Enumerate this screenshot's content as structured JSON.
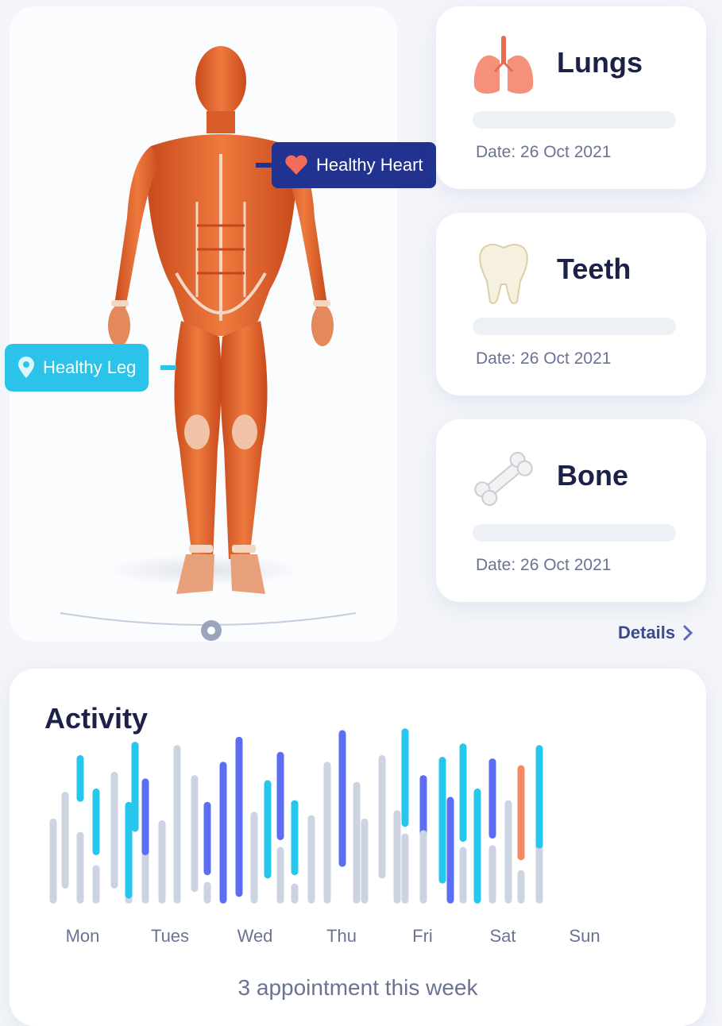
{
  "body_view": {
    "tags": {
      "heart": {
        "label": "Healthy Heart"
      },
      "leg": {
        "label": "Healthy Leg"
      }
    }
  },
  "organs": [
    {
      "name": "Lungs",
      "date": "Date: 26 Oct 2021",
      "icon": "lungs-icon"
    },
    {
      "name": "Teeth",
      "date": "Date: 26 Oct 2021",
      "icon": "tooth-icon"
    },
    {
      "name": "Bone",
      "date": "Date: 26 Oct 2021",
      "icon": "bone-icon"
    }
  ],
  "details_link": {
    "label": "Details"
  },
  "activity": {
    "title": "Activity",
    "summary": "3 appointment this week"
  },
  "colors": {
    "grey": "#ccd3e1",
    "cyan": "#25c7ee",
    "blue": "#5b6ef3",
    "orange": "#f48a66",
    "heart_tag": "#22338f",
    "leg_tag": "#2bc3ea"
  },
  "chart_data": {
    "type": "bar",
    "categories": [
      "Mon",
      "Tues",
      "Wed",
      "Thu",
      "Fri",
      "Sat",
      "Sun"
    ],
    "ylim": [
      0,
      100
    ],
    "grid": false,
    "legend": "none",
    "bars": [
      {
        "color": "grey",
        "low": 2,
        "high": 53
      },
      {
        "color": "grey",
        "low": 11,
        "high": 69
      },
      {
        "color": "grey",
        "low": 2,
        "high": 45
      },
      {
        "color": "cyan",
        "low": 63,
        "high": 91
      },
      {
        "color": "grey",
        "low": 2,
        "high": 25
      },
      {
        "color": "cyan",
        "low": 31,
        "high": 71
      },
      {
        "color": "grey",
        "low": 11,
        "high": 81
      },
      {
        "color": "grey",
        "low": 2,
        "high": 43
      },
      {
        "color": "cyan",
        "low": 5,
        "high": 63
      },
      {
        "color": "cyan",
        "low": 45,
        "high": 99
      },
      {
        "color": "grey",
        "low": 2,
        "high": 36
      },
      {
        "color": "blue",
        "low": 31,
        "high": 77
      },
      {
        "color": "grey",
        "low": 2,
        "high": 52
      },
      {
        "color": "grey",
        "low": 2,
        "high": 97
      },
      {
        "color": "grey",
        "low": 9,
        "high": 79
      },
      {
        "color": "grey",
        "low": 2,
        "high": 15
      },
      {
        "color": "blue",
        "low": 19,
        "high": 63
      },
      {
        "color": "blue",
        "low": 2,
        "high": 87
      },
      {
        "color": "blue",
        "low": 6,
        "high": 102
      },
      {
        "color": "grey",
        "low": 2,
        "high": 57
      },
      {
        "color": "cyan",
        "low": 17,
        "high": 76
      },
      {
        "color": "grey",
        "low": 2,
        "high": 36
      },
      {
        "color": "blue",
        "low": 40,
        "high": 93
      },
      {
        "color": "grey",
        "low": 2,
        "high": 14
      },
      {
        "color": "cyan",
        "low": 19,
        "high": 64
      },
      {
        "color": "grey",
        "low": 2,
        "high": 55
      },
      {
        "color": "grey",
        "low": 2,
        "high": 87
      },
      {
        "color": "blue",
        "low": 24,
        "high": 106
      },
      {
        "color": "grey",
        "low": 2,
        "high": 75
      },
      {
        "color": "grey",
        "low": 2,
        "high": 53
      },
      {
        "color": "grey",
        "low": 17,
        "high": 91
      },
      {
        "color": "grey",
        "low": 2,
        "high": 58
      },
      {
        "color": "cyan",
        "low": 48,
        "high": 107
      },
      {
        "color": "grey",
        "low": 2,
        "high": 44
      },
      {
        "color": "blue",
        "low": 21,
        "high": 79
      },
      {
        "color": "grey",
        "low": 2,
        "high": 46
      },
      {
        "color": "cyan",
        "low": 14,
        "high": 90
      },
      {
        "color": "blue",
        "low": 2,
        "high": 66
      },
      {
        "color": "grey",
        "low": 2,
        "high": 36
      },
      {
        "color": "cyan",
        "low": 39,
        "high": 98
      },
      {
        "color": "cyan",
        "low": 2,
        "high": 71
      },
      {
        "color": "grey",
        "low": 2,
        "high": 37
      },
      {
        "color": "blue",
        "low": 41,
        "high": 89
      },
      {
        "color": "grey",
        "low": 2,
        "high": 64
      },
      {
        "color": "grey",
        "low": 2,
        "high": 22
      },
      {
        "color": "orange",
        "low": 28,
        "high": 85
      },
      {
        "color": "grey",
        "low": 2,
        "high": 66
      },
      {
        "color": "cyan",
        "low": 35,
        "high": 97
      }
    ]
  }
}
